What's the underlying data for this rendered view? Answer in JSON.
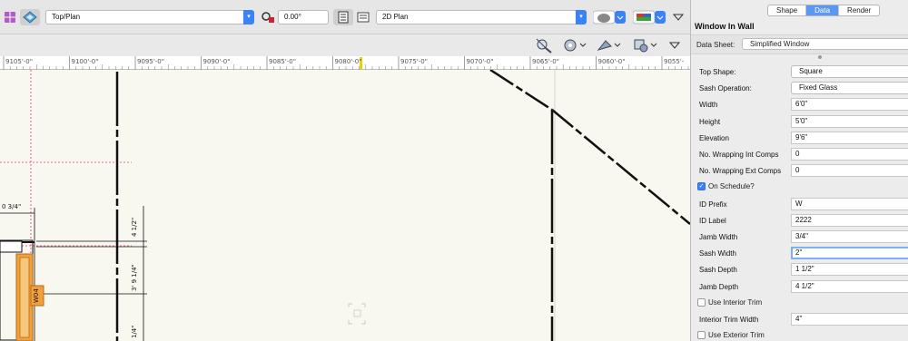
{
  "toolbar": {
    "view_select": "Top/Plan",
    "rotation_value": "0.00°",
    "render_select": "2D Plan"
  },
  "ruler": {
    "labels": [
      "9105'-0\"",
      "9100'-0\"",
      "9095'-0\"",
      "9090'-0\"",
      "9085'-0\"",
      "9080'-0\"",
      "9075'-0\"",
      "9070'-0\"",
      "9065'-0\"",
      "9060'-0\"",
      "9055'-"
    ]
  },
  "drawing": {
    "dim_top": "0 3/4\"",
    "dim_v1": "4 1/2\"",
    "dim_v2": "3' 9 1/4\"",
    "dim_v3": "1/4\"",
    "window_tag": "W04"
  },
  "palette": {
    "tabs": [
      "Shape",
      "Data",
      "Render"
    ],
    "active_tab": "Data",
    "title": "Window In Wall",
    "data_sheet_label": "Data Sheet:",
    "data_sheet_value": "Simplified Window",
    "rows": [
      {
        "label": "Top Shape:",
        "value": "Square"
      },
      {
        "label": "Sash Operation:",
        "value": "Fixed Glass"
      },
      {
        "label": "Width",
        "value": "6'0\""
      },
      {
        "label": "Height",
        "value": "5'0\""
      },
      {
        "label": "Elevation",
        "value": "9'6\""
      },
      {
        "label": "No. Wrapping Int Comps",
        "value": "0"
      },
      {
        "label": "No. Wrapping Ext Comps",
        "value": "0"
      },
      {
        "label": "On Schedule?",
        "checked": true
      },
      {
        "label": "ID Prefix",
        "value": "W"
      },
      {
        "label": "ID Label",
        "value": "2222"
      },
      {
        "label": "Jamb Width",
        "value": "3/4\""
      },
      {
        "label": "Sash Width",
        "value": "2\""
      },
      {
        "label": "Sash Depth",
        "value": "1 1/2\""
      },
      {
        "label": "Jamb Depth",
        "value": "4 1/2\""
      },
      {
        "label": "Use Interior Trim",
        "checked": false
      },
      {
        "label": "Interior Trim Width",
        "value": "4\""
      },
      {
        "label": "Use Exterior Trim",
        "checked": false
      }
    ]
  },
  "colors": {
    "accent": "#3b82f6",
    "tab_active": "#5b97f4",
    "window_orange": "#f0a040",
    "guide_pink": "#e0407a"
  }
}
